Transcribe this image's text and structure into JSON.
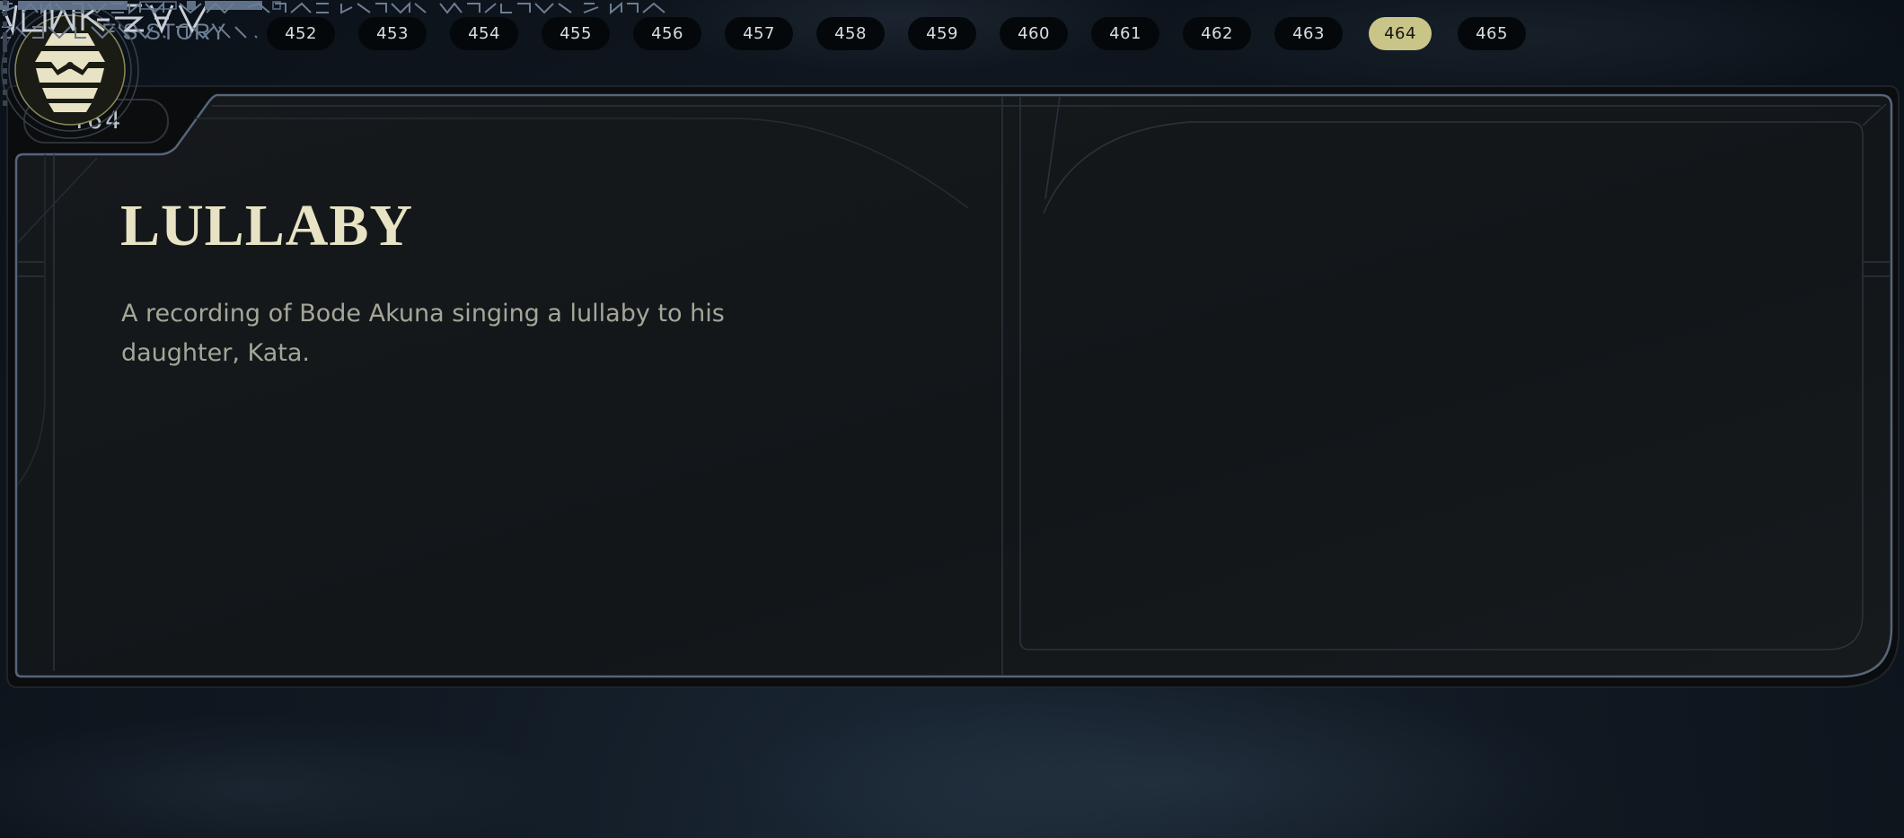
{
  "header": {
    "title": "BODE'S STORY",
    "chapters": [
      "452",
      "453",
      "454",
      "455",
      "456",
      "457",
      "458",
      "459",
      "460",
      "461",
      "462",
      "463",
      "464",
      "465"
    ],
    "active_chapter": "464"
  },
  "entry": {
    "number": "464",
    "title": "LULLABY",
    "description": "A recording of Bode Akuna singing a lullaby to his daughter, Kata.",
    "emblem_icon": "hexagon-emblem-icon"
  },
  "colors": {
    "accent": "#c9c488",
    "title": "#e8e3c4",
    "panel_border": "#4b5a6d",
    "aurebesh": "#6b7d93"
  }
}
